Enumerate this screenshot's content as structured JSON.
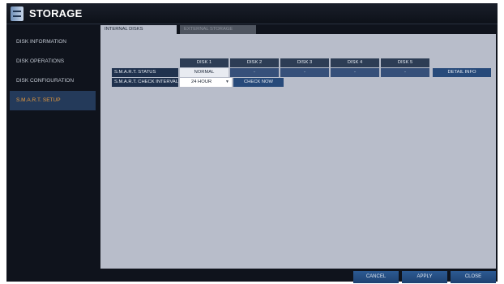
{
  "window": {
    "title": "STORAGE"
  },
  "sidebar": {
    "items": [
      {
        "label": "DISK INFORMATION"
      },
      {
        "label": "DISK OPERATIONS"
      },
      {
        "label": "DISK CONFIGURATION"
      },
      {
        "label": "S.M.A.R.T. SETUP"
      }
    ]
  },
  "tabs": [
    {
      "label": "INTERNAL DISKS"
    },
    {
      "label": "EXTERNAL STORAGE"
    }
  ],
  "table": {
    "headers": [
      "DISK 1",
      "DISK 2",
      "DISK 3",
      "DISK 4",
      "DISK 5"
    ],
    "status_label": "S.M.A.R.T. STATUS",
    "status_values": [
      "NORMAL",
      "-",
      "-",
      "-",
      "-"
    ],
    "interval_label": "S.M.A.R.T. CHECK INTERVAL",
    "interval_value": "24 HOUR"
  },
  "buttons": {
    "detail_info": "DETAIL INFO",
    "check_now": "CHECK NOW",
    "cancel": "CANCEL",
    "apply": "APPLY",
    "close": "CLOSE"
  }
}
